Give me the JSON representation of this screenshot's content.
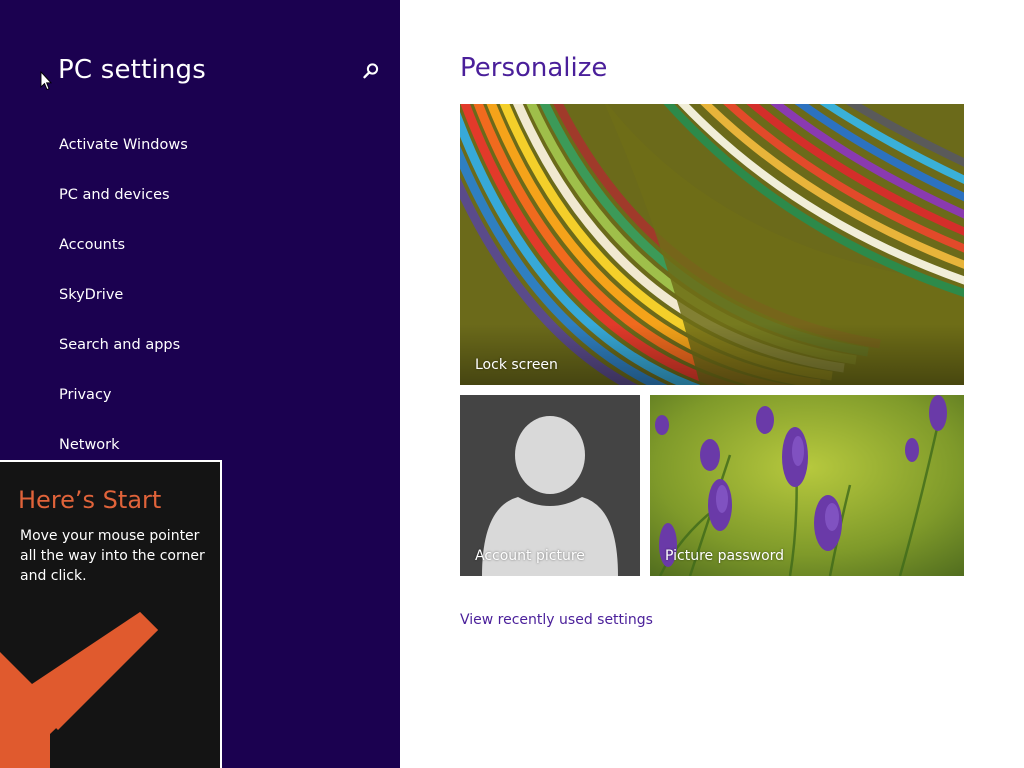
{
  "nav": {
    "title": "PC settings",
    "items": [
      {
        "label": "Activate Windows"
      },
      {
        "label": "PC and devices"
      },
      {
        "label": "Accounts"
      },
      {
        "label": "SkyDrive"
      },
      {
        "label": "Search and apps"
      },
      {
        "label": "Privacy"
      },
      {
        "label": "Network"
      }
    ]
  },
  "tip": {
    "title": "Here’s Start",
    "body": "Move your mouse pointer all the way into the corner and click."
  },
  "content": {
    "title": "Personalize",
    "tiles": {
      "lock_screen": "Lock screen",
      "account_picture": "Account picture",
      "picture_password": "Picture password"
    },
    "recent_link": "View recently used settings"
  },
  "icons": {
    "search": "search-icon",
    "cursor": "mouse-cursor-icon",
    "arrow": "arrow-down-left-icon",
    "user": "user-silhouette-icon"
  },
  "colors": {
    "nav_background": "#1b0150",
    "accent": "#4a1f9a",
    "tip_background": "#141414",
    "tip_title": "#e0633a",
    "tip_arrow": "#e05a2e"
  }
}
